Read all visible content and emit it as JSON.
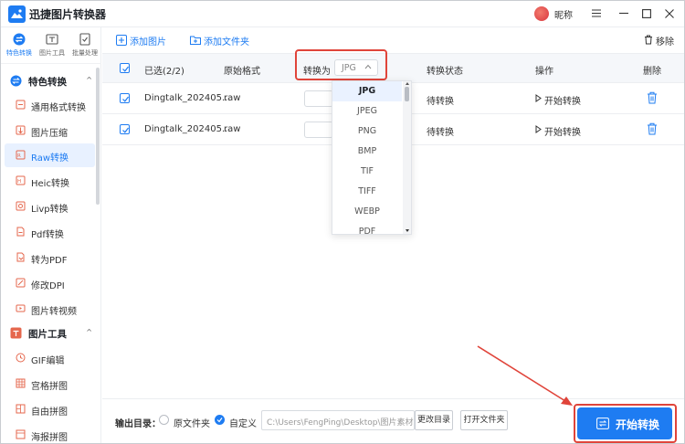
{
  "app": {
    "title": "迅捷图片转换器",
    "user_name": "昵称"
  },
  "sidebar": {
    "tabs": [
      {
        "label": "特色转换",
        "icon": "feature-convert-icon"
      },
      {
        "label": "图片工具",
        "icon": "image-tools-icon"
      },
      {
        "label": "批量处理",
        "icon": "batch-process-icon"
      }
    ],
    "groups": [
      {
        "label": "特色转换",
        "icon": "feature-convert-icon",
        "chevron": "^",
        "items": [
          "通用格式转换",
          "图片压缩",
          "Raw转换",
          "Heic转换",
          "Livp转换",
          "Pdf转换",
          "转为PDF",
          "修改DPI",
          "图片转视频"
        ]
      },
      {
        "label": "图片工具",
        "icon": "image-tools-icon",
        "chevron": "^",
        "items": [
          "GIF编辑",
          "宫格拼图",
          "自由拼图",
          "海报拼图"
        ]
      }
    ],
    "active_item": "Raw转换"
  },
  "toolbar": {
    "add_image": "添加图片",
    "add_folder": "添加文件夹",
    "remove": "移除"
  },
  "table": {
    "headers": {
      "selected": "已选(2/2)",
      "original_format": "原始格式",
      "convert_to": "转换为",
      "status": "转换状态",
      "action": "操作",
      "delete": "删除"
    },
    "convert_to_value": "JPG",
    "rows": [
      {
        "name": "Dingtalk_202405...",
        "format": "raw",
        "status": "待转换",
        "action": "开始转换",
        "checked": true
      },
      {
        "name": "Dingtalk_202405...",
        "format": "raw",
        "status": "待转换",
        "action": "开始转换",
        "checked": true
      }
    ]
  },
  "dropdown": {
    "options": [
      "JPG",
      "JPEG",
      "PNG",
      "BMP",
      "TIF",
      "TIFF",
      "WEBP",
      "PDF"
    ],
    "selected": "JPG"
  },
  "footer": {
    "output_label": "输出目录：",
    "radio_original": "原文件夹",
    "radio_custom": "自定义",
    "selected_radio": "自定义",
    "path": "C:\\Users\\FengPing\\Desktop\\图片素材",
    "change_dir": "更改目录",
    "open_folder": "打开文件夹",
    "start": "开始转换"
  },
  "colors": {
    "accent": "#1e7cf2",
    "highlight": "#e0443a",
    "active_bg": "#e8f1ff"
  }
}
